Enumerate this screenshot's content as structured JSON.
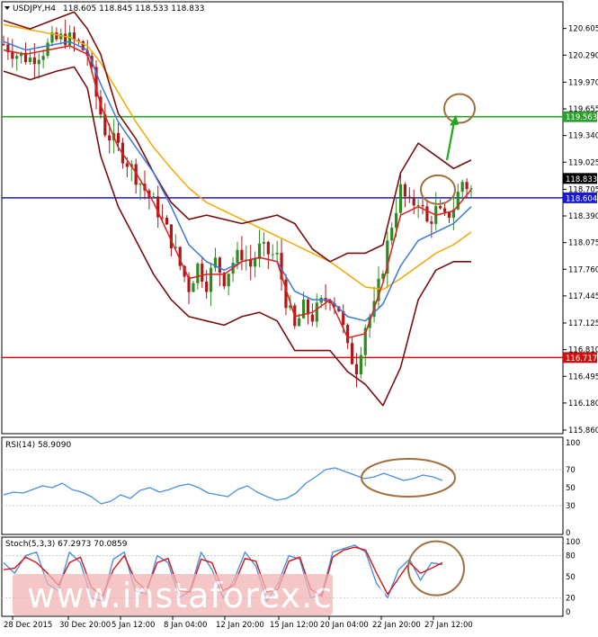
{
  "header": {
    "symbol": "USDJPY,H4",
    "ohlc": "118.605 118.845 118.533 118.833"
  },
  "colors": {
    "candle_up": "#2e8b22",
    "candle_down": "#b01818",
    "bollinger": "#7a0e0e",
    "ma_fast": "#e02020",
    "ma_mid": "#3c78d8",
    "ma_slow": "#f5a800",
    "resistance": "#2e9e2e",
    "pivot": "#1a1acc",
    "support": "#cc1111",
    "rsi_line": "#4a90e2",
    "stoch_main": "#4a90e2",
    "stoch_signal": "#dd1111",
    "annotation_circle": "#a0703c",
    "annotation_arrow": "#1ea81e",
    "watermark_bg": "#f2b4b4"
  },
  "watermark": "www.instaforex.com",
  "chart_data": [
    {
      "type": "candlestick",
      "title": "USDJPY,H4",
      "y_ticks": [
        "120.605",
        "120.290",
        "119.970",
        "119.655",
        "119.340",
        "119.025",
        "118.705",
        "118.390",
        "118.075",
        "117.760",
        "117.445",
        "117.125",
        "116.810",
        "116.495",
        "116.180",
        "115.860"
      ],
      "x_ticks": [
        "28 Dec 2015",
        "30 Dec 20:00",
        "5 Jan 12:00",
        "8 Jan 04:00",
        "12 Jan 20:00",
        "15 Jan 12:00",
        "20 Jan 04:00",
        "22 Jan 20:00",
        "27 Jan 12:00"
      ],
      "ylim": [
        115.86,
        120.75
      ],
      "horizontal_levels": [
        {
          "name": "resistance",
          "value": 119.563,
          "label": "119.563"
        },
        {
          "name": "pivot",
          "value": 118.604,
          "label": "118.604"
        },
        {
          "name": "support",
          "value": 116.717,
          "label": "116.717"
        }
      ],
      "current_price": {
        "value": 118.833,
        "label": "118.833"
      },
      "close_path": [
        [
          0,
          120.42
        ],
        [
          3,
          120.3
        ],
        [
          6,
          120.25
        ],
        [
          9,
          120.35
        ],
        [
          11,
          120.45
        ],
        [
          14,
          120.5
        ],
        [
          17,
          120.42
        ],
        [
          19,
          120.3
        ],
        [
          21,
          119.8
        ],
        [
          23,
          119.4
        ],
        [
          26,
          119.2
        ],
        [
          29,
          118.95
        ],
        [
          32,
          118.7
        ],
        [
          35,
          118.45
        ],
        [
          38,
          118.1
        ],
        [
          40,
          117.8
        ],
        [
          42,
          117.55
        ],
        [
          44,
          117.8
        ],
        [
          46,
          117.6
        ],
        [
          48,
          117.85
        ],
        [
          50,
          117.65
        ],
        [
          52,
          117.85
        ],
        [
          54,
          117.95
        ],
        [
          56,
          117.8
        ],
        [
          58,
          118.0
        ],
        [
          60,
          117.95
        ],
        [
          62,
          117.9
        ],
        [
          64,
          117.4
        ],
        [
          66,
          117.05
        ],
        [
          68,
          117.3
        ],
        [
          70,
          117.2
        ],
        [
          72,
          117.35
        ],
        [
          74,
          117.45
        ],
        [
          76,
          117.3
        ],
        [
          78,
          116.8
        ],
        [
          80,
          116.6
        ],
        [
          82,
          117.1
        ],
        [
          84,
          117.3
        ],
        [
          86,
          117.8
        ],
        [
          88,
          118.3
        ],
        [
          90,
          118.7
        ],
        [
          92,
          118.5
        ],
        [
          94,
          118.6
        ],
        [
          96,
          118.3
        ],
        [
          98,
          118.45
        ],
        [
          100,
          118.35
        ],
        [
          102,
          118.5
        ],
        [
          104,
          118.8
        ],
        [
          106,
          118.7
        ]
      ],
      "ma_fast": [
        [
          0,
          120.35
        ],
        [
          5,
          120.3
        ],
        [
          10,
          120.35
        ],
        [
          15,
          120.4
        ],
        [
          19,
          120.3
        ],
        [
          22,
          119.7
        ],
        [
          26,
          119.2
        ],
        [
          30,
          118.9
        ],
        [
          34,
          118.55
        ],
        [
          38,
          118.1
        ],
        [
          42,
          117.65
        ],
        [
          46,
          117.7
        ],
        [
          50,
          117.7
        ],
        [
          54,
          117.85
        ],
        [
          58,
          117.9
        ],
        [
          62,
          117.85
        ],
        [
          66,
          117.2
        ],
        [
          70,
          117.25
        ],
        [
          74,
          117.4
        ],
        [
          78,
          116.95
        ],
        [
          82,
          117.0
        ],
        [
          86,
          117.6
        ],
        [
          90,
          118.4
        ],
        [
          94,
          118.5
        ],
        [
          98,
          118.4
        ],
        [
          102,
          118.45
        ],
        [
          106,
          118.7
        ]
      ],
      "ma_mid": [
        [
          0,
          120.45
        ],
        [
          5,
          120.35
        ],
        [
          10,
          120.4
        ],
        [
          15,
          120.45
        ],
        [
          19,
          120.35
        ],
        [
          22,
          119.95
        ],
        [
          26,
          119.5
        ],
        [
          30,
          119.2
        ],
        [
          34,
          118.9
        ],
        [
          38,
          118.5
        ],
        [
          42,
          118.05
        ],
        [
          46,
          117.85
        ],
        [
          50,
          117.75
        ],
        [
          54,
          117.85
        ],
        [
          58,
          117.9
        ],
        [
          62,
          117.85
        ],
        [
          66,
          117.5
        ],
        [
          70,
          117.4
        ],
        [
          74,
          117.4
        ],
        [
          78,
          117.2
        ],
        [
          82,
          117.15
        ],
        [
          86,
          117.35
        ],
        [
          90,
          117.8
        ],
        [
          94,
          118.1
        ],
        [
          98,
          118.2
        ],
        [
          102,
          118.3
        ],
        [
          106,
          118.5
        ]
      ],
      "ma_slow": [
        [
          0,
          120.65
        ],
        [
          5,
          120.6
        ],
        [
          10,
          120.55
        ],
        [
          15,
          120.5
        ],
        [
          19,
          120.4
        ],
        [
          22,
          120.2
        ],
        [
          26,
          119.85
        ],
        [
          30,
          119.5
        ],
        [
          34,
          119.2
        ],
        [
          38,
          118.95
        ],
        [
          42,
          118.72
        ],
        [
          46,
          118.55
        ],
        [
          50,
          118.45
        ],
        [
          54,
          118.35
        ],
        [
          58,
          118.25
        ],
        [
          62,
          118.15
        ],
        [
          66,
          118.05
        ],
        [
          70,
          117.95
        ],
        [
          74,
          117.85
        ],
        [
          78,
          117.7
        ],
        [
          82,
          117.55
        ],
        [
          86,
          117.52
        ],
        [
          90,
          117.65
        ],
        [
          94,
          117.8
        ],
        [
          98,
          117.95
        ],
        [
          102,
          118.05
        ],
        [
          106,
          118.2
        ]
      ],
      "bollinger_upper": [
        [
          0,
          120.7
        ],
        [
          6,
          120.6
        ],
        [
          12,
          120.72
        ],
        [
          16,
          120.8
        ],
        [
          19,
          120.6
        ],
        [
          22,
          120.3
        ],
        [
          26,
          119.6
        ],
        [
          30,
          119.3
        ],
        [
          34,
          118.9
        ],
        [
          38,
          118.55
        ],
        [
          42,
          118.35
        ],
        [
          46,
          118.4
        ],
        [
          50,
          118.35
        ],
        [
          54,
          118.3
        ],
        [
          58,
          118.35
        ],
        [
          62,
          118.4
        ],
        [
          66,
          118.3
        ],
        [
          70,
          118.0
        ],
        [
          74,
          117.85
        ],
        [
          78,
          117.95
        ],
        [
          82,
          117.95
        ],
        [
          86,
          118.05
        ],
        [
          90,
          118.9
        ],
        [
          94,
          119.25
        ],
        [
          98,
          119.1
        ],
        [
          102,
          118.95
        ],
        [
          106,
          119.05
        ]
      ],
      "bollinger_lower": [
        [
          0,
          120.1
        ],
        [
          6,
          120.0
        ],
        [
          12,
          120.1
        ],
        [
          16,
          120.15
        ],
        [
          19,
          119.9
        ],
        [
          22,
          119.1
        ],
        [
          26,
          118.5
        ],
        [
          30,
          118.1
        ],
        [
          34,
          117.7
        ],
        [
          38,
          117.4
        ],
        [
          42,
          117.2
        ],
        [
          46,
          117.15
        ],
        [
          50,
          117.1
        ],
        [
          54,
          117.2
        ],
        [
          58,
          117.25
        ],
        [
          62,
          117.15
        ],
        [
          66,
          116.8
        ],
        [
          70,
          116.8
        ],
        [
          74,
          116.8
        ],
        [
          78,
          116.55
        ],
        [
          82,
          116.4
        ],
        [
          86,
          116.15
        ],
        [
          90,
          116.6
        ],
        [
          94,
          117.4
        ],
        [
          98,
          117.75
        ],
        [
          102,
          117.85
        ],
        [
          106,
          117.85
        ]
      ]
    },
    {
      "type": "line",
      "title": "RSI(14) 58.9090",
      "ylim": [
        0,
        100
      ],
      "y_ticks": [
        "100",
        "70",
        "50",
        "30",
        "0"
      ],
      "series": [
        {
          "values": [
            42,
            45,
            44,
            48,
            52,
            50,
            55,
            48,
            45,
            40,
            32,
            35,
            42,
            38,
            47,
            50,
            45,
            48,
            52,
            54,
            50,
            44,
            42,
            40,
            48,
            52,
            45,
            40,
            36,
            38,
            44,
            55,
            62,
            70,
            72,
            68,
            64,
            60,
            62,
            66,
            62,
            58,
            60,
            64,
            62,
            58
          ]
        }
      ]
    },
    {
      "type": "line",
      "title": "Stoch(5,3,3) 67.2973 70.0859",
      "ylim": [
        0,
        100
      ],
      "y_ticks": [
        "100",
        "80",
        "50",
        "20",
        "0"
      ],
      "series": [
        {
          "values": [
            70,
            55,
            80,
            85,
            40,
            30,
            85,
            70,
            20,
            15,
            75,
            85,
            30,
            25,
            80,
            70,
            20,
            30,
            85,
            60,
            20,
            45,
            85,
            65,
            15,
            40,
            80,
            75,
            20,
            25,
            85,
            90,
            95,
            85,
            40,
            20,
            60,
            75,
            45,
            70,
            67
          ]
        },
        {
          "values": [
            60,
            62,
            78,
            70,
            55,
            38,
            70,
            78,
            35,
            22,
            60,
            80,
            45,
            30,
            70,
            76,
            30,
            28,
            75,
            70,
            30,
            38,
            76,
            72,
            28,
            32,
            72,
            78,
            32,
            22,
            78,
            88,
            92,
            88,
            55,
            25,
            48,
            70,
            55,
            62,
            70
          ]
        }
      ]
    }
  ]
}
